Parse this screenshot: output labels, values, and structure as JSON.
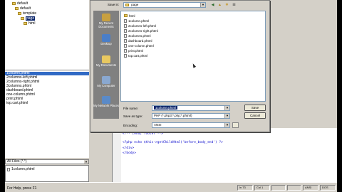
{
  "tree": {
    "items": [
      {
        "label": "default",
        "type": "folder"
      },
      {
        "label": "default",
        "type": "folder"
      },
      {
        "label": "template",
        "type": "folder"
      },
      {
        "label": "page",
        "type": "folder",
        "selected": true
      },
      {
        "label": "html",
        "type": "folder"
      }
    ]
  },
  "file_list": {
    "items": [
      "1column.phtml",
      "2columns-left.phtml",
      "2columns-right.phtml",
      "3columns.phtml",
      "dashboard.phtml",
      "one-column.phtml",
      "print.phtml",
      "top.cart.phtml"
    ],
    "selected_index": 0
  },
  "filter": {
    "value": "All Files (*.*)"
  },
  "open_files": [
    {
      "label": "1column.phtml"
    }
  ],
  "status": {
    "help_text": "For Help, press F1",
    "cells": [
      "ln 73",
      "Col 1",
      "",
      "",
      "ANSI",
      "DOS"
    ]
  },
  "editor": {
    "lines": [
      {
        "num": "",
        "text": "<!-- [end] footer -->"
      },
      {
        "num": "",
        "text": "<?php echo $this->getChildHtml('before_body_end') ?>"
      },
      {
        "num": "",
        "text": "</div>"
      },
      {
        "num": "",
        "text": "</body>"
      }
    ]
  },
  "dialog": {
    "save_in_label": "Save in:",
    "save_in_value": "page",
    "places": [
      {
        "label": "My Recent Documents",
        "icon": "recent-documents-icon",
        "color": "#c8a040"
      },
      {
        "label": "Desktop",
        "icon": "desktop-icon",
        "color": "#4a7ec8"
      },
      {
        "label": "My Documents",
        "icon": "my-documents-icon",
        "color": "#e8c860"
      },
      {
        "label": "My Computer",
        "icon": "my-computer-icon",
        "color": "#8aa8d0"
      },
      {
        "label": "My Network Places",
        "icon": "network-places-icon",
        "color": "#5a8ac8"
      }
    ],
    "browser_items": [
      {
        "label": "html",
        "type": "folder"
      },
      {
        "label": "1column.phtml",
        "type": "file"
      },
      {
        "label": "2columns-left.phtml",
        "type": "file"
      },
      {
        "label": "2columns-right.phtml",
        "type": "file"
      },
      {
        "label": "3columns.phtml",
        "type": "file"
      },
      {
        "label": "dashboard.phtml",
        "type": "file"
      },
      {
        "label": "one-column.phtml",
        "type": "file"
      },
      {
        "label": "print.phtml",
        "type": "file"
      },
      {
        "label": "top.cart.phtml",
        "type": "file"
      }
    ],
    "file_name_label": "File name:",
    "file_name_value": "1column.phtml",
    "save_type_label": "Save as type:",
    "save_type_value": "PHP (*.php3;*.php;*.phtml)",
    "encoding_label": "Encoding:",
    "encoding_value": "ANSI",
    "save_button": "Save",
    "cancel_button": "Cancel"
  }
}
